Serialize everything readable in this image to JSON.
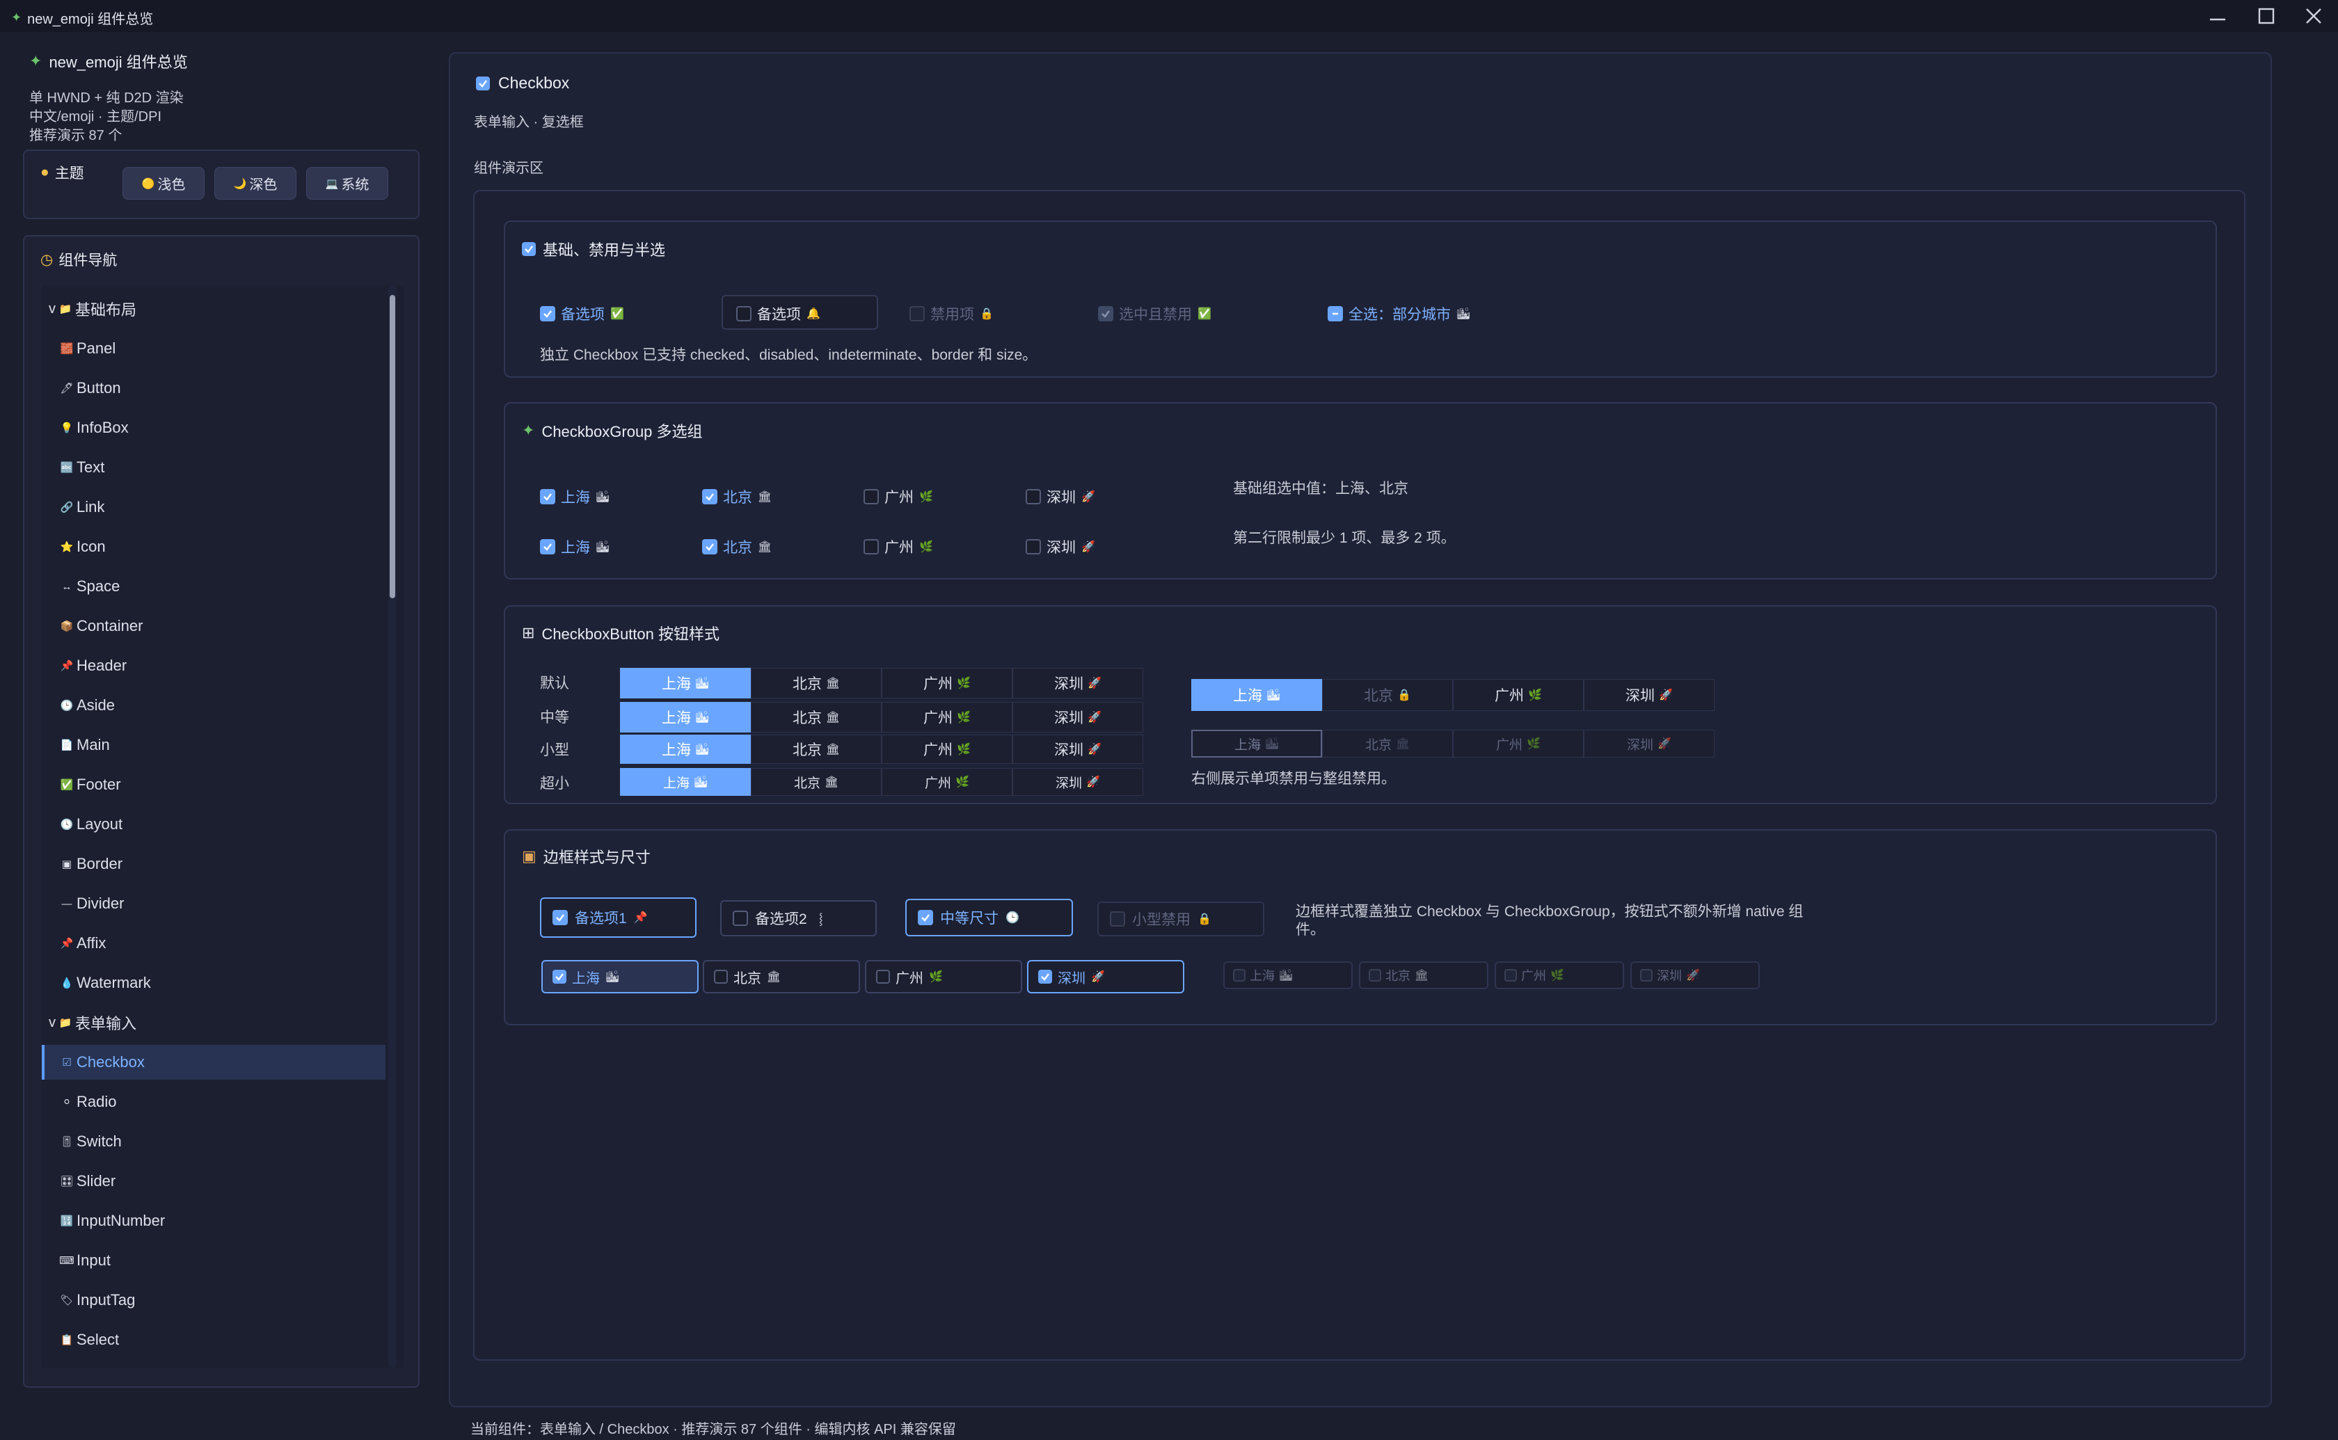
{
  "window": {
    "title": "new_emoji 组件总览"
  },
  "sidebar": {
    "app_name": "new_emoji 组件总览",
    "lines": [
      "单 HWND + 纯 D2D 渲染",
      "中文/emoji · 主题/DPI",
      "推荐演示 87 个"
    ],
    "theme": {
      "title": "主题",
      "buttons": [
        {
          "label": "浅色",
          "icon": "🟡"
        },
        {
          "label": "深色",
          "icon": "🌙"
        },
        {
          "label": "系统",
          "icon": "💻"
        }
      ]
    },
    "nav": {
      "title": "组件导航",
      "items": [
        {
          "label": "基础布局",
          "icon": "📁",
          "prefix": "v",
          "group": true
        },
        {
          "label": "Panel",
          "icon": "🧱"
        },
        {
          "label": "Button",
          "icon": "🖊"
        },
        {
          "label": "InfoBox",
          "icon": "💡"
        },
        {
          "label": "Text",
          "icon": "🔤"
        },
        {
          "label": "Link",
          "icon": "🔗"
        },
        {
          "label": "Icon",
          "icon": "⭐"
        },
        {
          "label": "Space",
          "icon": "↔"
        },
        {
          "label": "Container",
          "icon": "📦"
        },
        {
          "label": "Header",
          "icon": "📌"
        },
        {
          "label": "Aside",
          "icon": "🕒"
        },
        {
          "label": "Main",
          "icon": "📄"
        },
        {
          "label": "Footer",
          "icon": "✅"
        },
        {
          "label": "Layout",
          "icon": "🕓"
        },
        {
          "label": "Border",
          "icon": "▣"
        },
        {
          "label": "Divider",
          "icon": "—"
        },
        {
          "label": "Affix",
          "icon": "📌"
        },
        {
          "label": "Watermark",
          "icon": "💧"
        },
        {
          "label": "表单输入",
          "icon": "📁",
          "prefix": "v",
          "group": true
        },
        {
          "label": "Checkbox",
          "icon": "☑",
          "active": true
        },
        {
          "label": "Radio",
          "icon": "⚪"
        },
        {
          "label": "Switch",
          "icon": "🎚"
        },
        {
          "label": "Slider",
          "icon": "🎛"
        },
        {
          "label": "InputNumber",
          "icon": "🔢"
        },
        {
          "label": "Input",
          "icon": "⌨"
        },
        {
          "label": "InputTag",
          "icon": "🏷"
        },
        {
          "label": "Select",
          "icon": "📋"
        }
      ]
    }
  },
  "main": {
    "title": "Checkbox",
    "subtitle": "表单输入 · 复选框",
    "demo_label": "组件演示区",
    "sections": {
      "basic": {
        "title": "基础、禁用与半选",
        "items": [
          {
            "label": "备选项",
            "emoji": "✅"
          },
          {
            "label": "备选项",
            "emoji": "🔔"
          },
          {
            "label": "禁用项",
            "emoji": "🔒"
          },
          {
            "label": "选中且禁用",
            "emoji": "✅"
          },
          {
            "label": "全选：部分城市",
            "emoji": "🏙"
          }
        ],
        "note": "独立 Checkbox 已支持 checked、disabled、indeterminate、border 和 size。"
      },
      "group": {
        "title": "CheckboxGroup 多选组",
        "cities": [
          {
            "label": "上海",
            "emoji": "🏙"
          },
          {
            "label": "北京",
            "emoji": "🏛"
          },
          {
            "label": "广州",
            "emoji": "🌿"
          },
          {
            "label": "深圳",
            "emoji": "🚀"
          }
        ],
        "note1": "基础组选中值：上海、北京",
        "note2": "第二行限制最少 1 项、最多 2 项。"
      },
      "button": {
        "title": "CheckboxButton 按钮样式",
        "sizes": [
          "默认",
          "中等",
          "小型",
          "超小"
        ],
        "note": "右侧展示单项禁用与整组禁用。"
      },
      "border": {
        "title": "边框样式与尺寸",
        "items": [
          {
            "label": "备选项1",
            "emoji": "📌"
          },
          {
            "label": "备选项2",
            "emoji": "⸾"
          },
          {
            "label": "中等尺寸",
            "emoji": "🕒"
          },
          {
            "label": "小型禁用",
            "emoji": "🔒"
          }
        ],
        "note": "边框样式覆盖独立 Checkbox 与 CheckboxGroup，按钮式不额外新增 native 组件。"
      }
    }
  },
  "status": "当前组件：表单输入 / Checkbox · 推荐演示 87 个组件 · 编辑内核 API 兼容保留"
}
